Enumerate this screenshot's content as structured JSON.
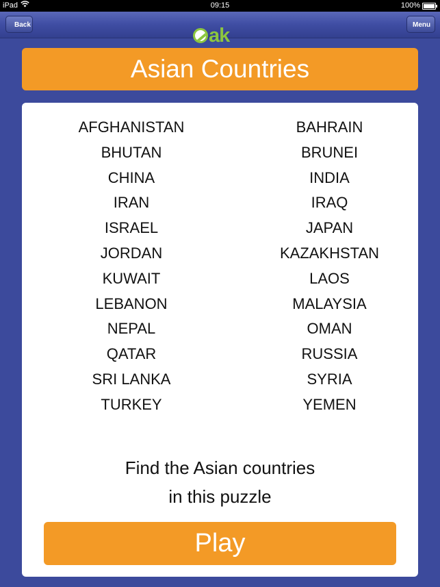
{
  "status": {
    "device": "iPad",
    "time": "09:15",
    "battery": "100%"
  },
  "nav": {
    "back_label": "Back",
    "menu_label": "Menu",
    "logo_text": "ak"
  },
  "title": "Asian Countries",
  "words": [
    [
      "AFGHANISTAN",
      "BAHRAIN"
    ],
    [
      "BHUTAN",
      "BRUNEI"
    ],
    [
      "CHINA",
      "INDIA"
    ],
    [
      "IRAN",
      "IRAQ"
    ],
    [
      "ISRAEL",
      "JAPAN"
    ],
    [
      "JORDAN",
      "KAZAKHSTAN"
    ],
    [
      "KUWAIT",
      "LAOS"
    ],
    [
      "LEBANON",
      "MALAYSIA"
    ],
    [
      "NEPAL",
      "OMAN"
    ],
    [
      "QATAR",
      "RUSSIA"
    ],
    [
      "SRI LANKA",
      "SYRIA"
    ],
    [
      "TURKEY",
      "YEMEN"
    ]
  ],
  "instructions": {
    "line1": "Find the Asian countries",
    "line2": "in this puzzle"
  },
  "play_label": "Play",
  "colors": {
    "background": "#3c4a9c",
    "accent": "#f39a26",
    "logo": "#8cc63f"
  }
}
